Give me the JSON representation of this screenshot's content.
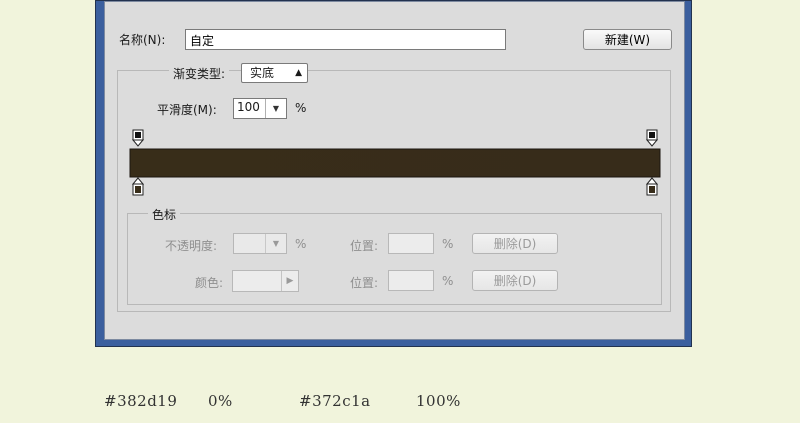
{
  "dialog": {
    "name_label": "名称(N):",
    "name_value": "自定",
    "new_button": "新建(W)",
    "gradient_type_label": "渐变类型:",
    "gradient_type_value": "实底",
    "smoothness_label": "平滑度(M):",
    "smoothness_value": "100",
    "smoothness_unit": "%",
    "gradient": {
      "start_color": "#382d19",
      "end_color": "#372c1a",
      "opacity_stops": [
        0,
        100
      ],
      "color_stops": [
        0,
        100
      ]
    },
    "color_stop_group": {
      "legend": "色标",
      "opacity_label": "不透明度:",
      "opacity_unit": "%",
      "location_label_1": "位置:",
      "location_unit_1": "%",
      "delete_button_1": "删除(D)",
      "color_label": "颜色:",
      "location_label_2": "位置:",
      "location_unit_2": "%",
      "delete_button_2": "删除(D)"
    }
  },
  "footer": {
    "stop1_hex": "#382d19",
    "stop1_pos": "0%",
    "stop2_hex": "#372c1a",
    "stop2_pos": "100%"
  },
  "colors": {
    "window_frame": "#3b5f9e",
    "dialog_bg": "#dcdcdc",
    "page_bg": "#f1f4dc"
  }
}
